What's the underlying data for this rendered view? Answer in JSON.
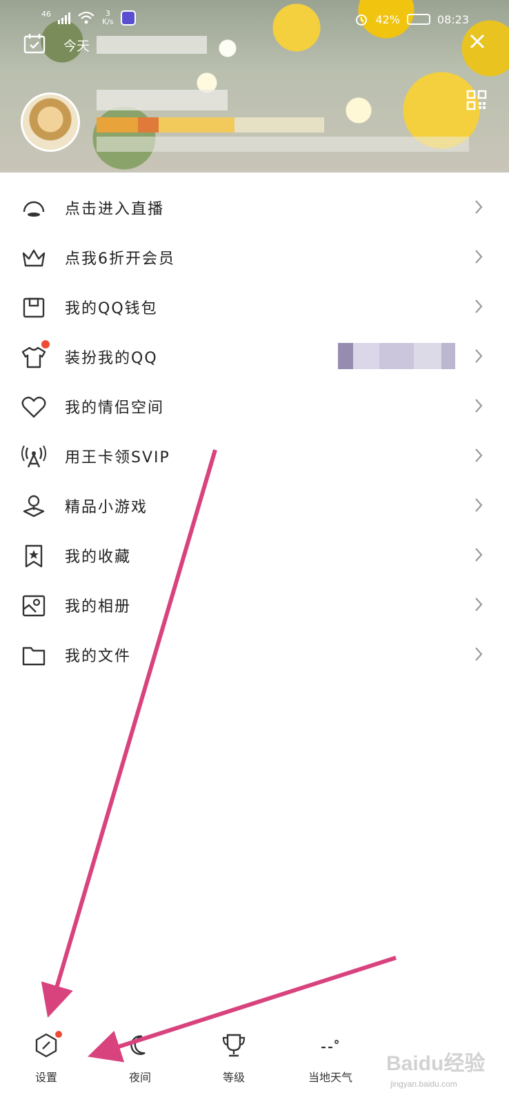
{
  "status_bar": {
    "network_type": "46",
    "speed_value": "3",
    "speed_unit": "K/s",
    "battery": "42%",
    "time": "08:23"
  },
  "header": {
    "today_label": "今天"
  },
  "menu": [
    {
      "label": "点击进入直播",
      "icon": "live-dome-icon"
    },
    {
      "label": "点我6折开会员",
      "icon": "crown-icon"
    },
    {
      "label": "我的QQ钱包",
      "icon": "wallet-icon"
    },
    {
      "label": "装扮我的QQ",
      "icon": "tshirt-icon"
    },
    {
      "label": "我的情侣空间",
      "icon": "heart-icon"
    },
    {
      "label": "用王卡领SVIP",
      "icon": "antenna-icon"
    },
    {
      "label": "精品小游戏",
      "icon": "game-icon"
    },
    {
      "label": "我的收藏",
      "icon": "bookmark-star-icon"
    },
    {
      "label": "我的相册",
      "icon": "photo-icon"
    },
    {
      "label": "我的文件",
      "icon": "folder-icon"
    }
  ],
  "bottom_bar": {
    "settings": "设置",
    "night": "夜间",
    "level": "等级",
    "weather": "当地天气"
  },
  "watermark": {
    "logo": "Baidu经验",
    "url": "jingyan.baidu.com"
  },
  "colors": {
    "arrow": "#d8437e",
    "badge": "#ee4b35"
  }
}
